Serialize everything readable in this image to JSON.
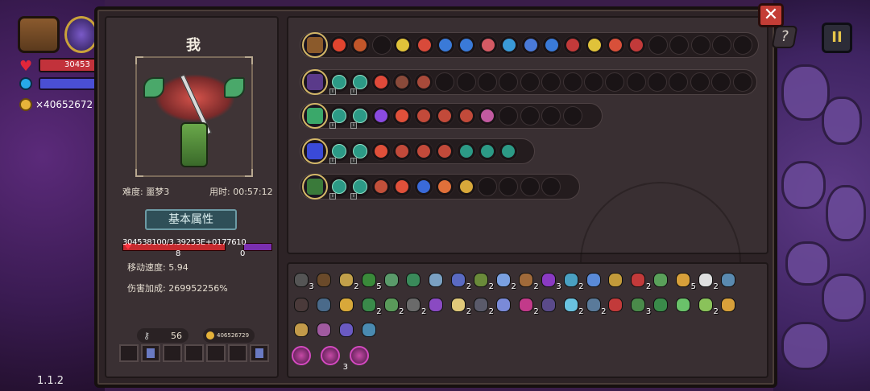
{
  "hud": {
    "hp_text": "30453",
    "gold_text": "×40652672",
    "version": "1.1.2"
  },
  "character": {
    "name": "我",
    "difficulty": "难度: 噩梦3",
    "time_used": "用时: 00:57:12",
    "basic_title": "基本属性",
    "hp_text": "304538100/3.39253E+0177610",
    "hp_sub": "8",
    "mp_sub": "0",
    "move_speed": "移动速度: 5.94",
    "damage_bonus": "伤害加成: 269952256%",
    "keys": "56",
    "gold": "406526729"
  },
  "buttons": {
    "close": "✕",
    "help": "?",
    "pause": "II"
  },
  "weapons": [
    {
      "main_color": "#8b5a2b",
      "icons": [
        "#e2452f",
        "#c2562a",
        "",
        "#e0c23a",
        "#d84a3a",
        "#3a7ad8",
        "#3a7ad8",
        "#d45a64",
        "#3a9ad8",
        "#4a7ad8",
        "#3a7ad8",
        "#c23a3a",
        "#e0c23a",
        "#d8503a",
        "#c23a3a",
        "",
        "",
        "",
        "",
        ""
      ]
    },
    {
      "main_color": "#5a3a8a",
      "icons": [
        "#e04a3a",
        "#8a4a3a",
        "#a84a3a",
        "",
        "",
        "",
        "",
        "",
        "",
        "",
        "",
        "",
        "",
        "",
        "",
        "",
        "",
        ""
      ]
    },
    {
      "main_color": "#3aa86a",
      "icons": [
        "#8a4ae0",
        "#e0503a",
        "#c24a3a",
        "#c24a3a",
        "#c24a3a",
        "#c25aa0",
        "",
        "",
        "",
        ""
      ]
    },
    {
      "main_color": "#3a4ad8",
      "icons": [
        "#e0503a",
        "#c24a3a",
        "#c24a3a",
        "#c24a3a",
        "#2c9a86",
        "#2c9a86",
        "#2c9a86"
      ]
    },
    {
      "main_color": "#3a7a3a",
      "icons": [
        "#c2503a",
        "#e0503a",
        "#3a6ad8",
        "#e0703a",
        "#d8a83a",
        "",
        "",
        "",
        ""
      ]
    }
  ],
  "inventory": [
    [
      {
        "c": "#555",
        "n": "3"
      },
      {
        "c": "#6a4a2a",
        "n": ""
      },
      {
        "c": "#c2a04a",
        "n": "2"
      },
      {
        "c": "#3a8a3a",
        "n": "5"
      },
      {
        "c": "#5a9a6a",
        "n": ""
      },
      {
        "c": "#3a8a5a",
        "n": ""
      },
      {
        "c": "#7aa0c2",
        "n": ""
      },
      {
        "c": "#5a6ac2",
        "n": "2"
      },
      {
        "c": "#6a8a3a",
        "n": "2"
      },
      {
        "c": "#7aa0e0",
        "n": "2"
      },
      {
        "c": "#a06a3a",
        "n": "2"
      },
      {
        "c": "#8a3ac2",
        "n": "3"
      },
      {
        "c": "#4aa0c2",
        "n": "2"
      },
      {
        "c": "#5a8ad8",
        "n": ""
      },
      {
        "c": "#c29a3a",
        "n": ""
      },
      {
        "c": "#c23a3a",
        "n": "2"
      },
      {
        "c": "#5aa05a",
        "n": ""
      },
      {
        "c": "#d8a03a",
        "n": "5"
      },
      {
        "c": "#e0e0e0",
        "n": "2"
      },
      {
        "c": "#5a8ab0",
        "n": ""
      }
    ],
    [
      {
        "c": "#4a3a3a",
        "n": ""
      },
      {
        "c": "#4a6a8a",
        "n": ""
      },
      {
        "c": "#d8a83a",
        "n": ""
      },
      {
        "c": "#3a8a4a",
        "n": "2"
      },
      {
        "c": "#5a9a5a",
        "n": "2"
      },
      {
        "c": "#6a6a6a",
        "n": "2"
      },
      {
        "c": "#8a4ac2",
        "n": ""
      },
      {
        "c": "#e0c87a",
        "n": "2"
      },
      {
        "c": "#5a5a6a",
        "n": "2"
      },
      {
        "c": "#7a8ad8",
        "n": ""
      },
      {
        "c": "#c23a8a",
        "n": "2"
      },
      {
        "c": "#5a4a8a",
        "n": ""
      },
      {
        "c": "#6ac2e0",
        "n": "2"
      },
      {
        "c": "#5a7a9a",
        "n": "2"
      },
      {
        "c": "#c23a3a",
        "n": ""
      },
      {
        "c": "#4a8a4a",
        "n": "3"
      },
      {
        "c": "#3a8a4a",
        "n": ""
      },
      {
        "c": "#6ac26a",
        "n": ""
      },
      {
        "c": "#8ac25a",
        "n": "2"
      },
      {
        "c": "#d8a03a",
        "n": ""
      }
    ],
    [
      {
        "c": "#c29a4a",
        "n": ""
      },
      {
        "c": "#a05aa0",
        "n": ""
      },
      {
        "c": "#6a5ac2",
        "n": ""
      },
      {
        "c": "#4a8ab0",
        "n": ""
      }
    ]
  ],
  "potions": [
    {
      "n": ""
    },
    {
      "n": "3"
    },
    {
      "n": ""
    }
  ]
}
